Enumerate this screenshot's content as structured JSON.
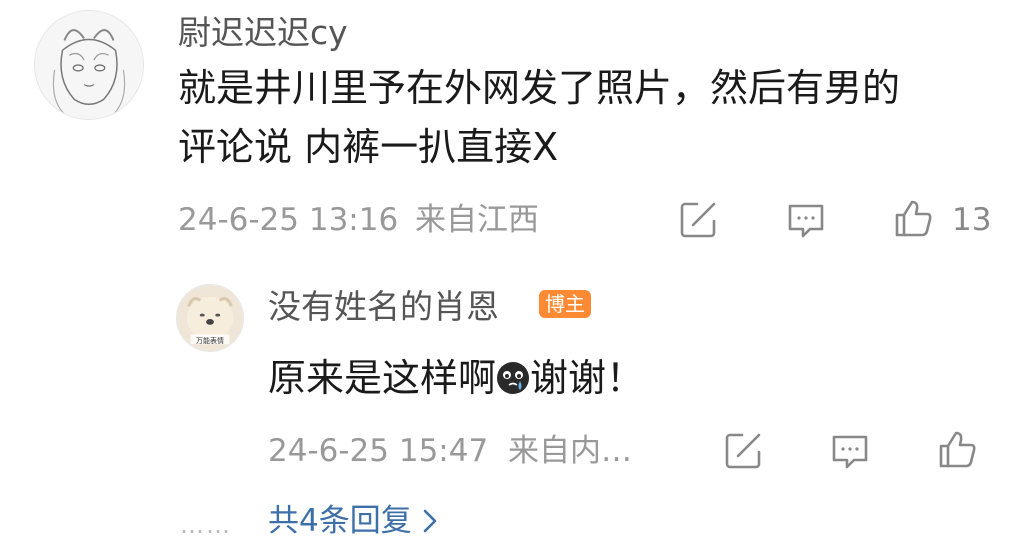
{
  "comment": {
    "username": "尉迟迟迟cy",
    "text_line1": "就是井川里予在外网发了照片，然后有男的",
    "text_line2": "评论说 内裤一扒直接X",
    "date": "24-6-25 13:16",
    "source": "来自江西",
    "like_count": "13"
  },
  "reply": {
    "username": "没有姓名的肖恩",
    "badge": "博主",
    "text_before_emoji": "原来是这样啊",
    "text_after_emoji": "谢谢！",
    "date": "24-6-25 15:47",
    "source": "来自内…",
    "avatar_caption": "万能表情"
  },
  "replies_summary": {
    "dots": "……",
    "label": "共4条回复"
  },
  "colors": {
    "badge": "#ff8a34",
    "link": "#3d6fa8",
    "meta": "#999999"
  },
  "icons": {
    "share": "share-icon",
    "comment": "comment-icon",
    "like": "like-icon",
    "emoji": "crying-emoji-icon",
    "chevron": "chevron-right-icon"
  }
}
